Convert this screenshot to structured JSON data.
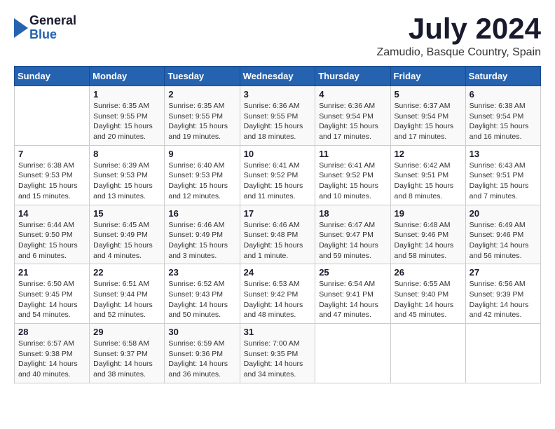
{
  "header": {
    "logo_line1": "General",
    "logo_line2": "Blue",
    "month": "July 2024",
    "location": "Zamudio, Basque Country, Spain"
  },
  "weekdays": [
    "Sunday",
    "Monday",
    "Tuesday",
    "Wednesday",
    "Thursday",
    "Friday",
    "Saturday"
  ],
  "weeks": [
    [
      {
        "day": "",
        "info": ""
      },
      {
        "day": "1",
        "info": "Sunrise: 6:35 AM\nSunset: 9:55 PM\nDaylight: 15 hours\nand 20 minutes."
      },
      {
        "day": "2",
        "info": "Sunrise: 6:35 AM\nSunset: 9:55 PM\nDaylight: 15 hours\nand 19 minutes."
      },
      {
        "day": "3",
        "info": "Sunrise: 6:36 AM\nSunset: 9:55 PM\nDaylight: 15 hours\nand 18 minutes."
      },
      {
        "day": "4",
        "info": "Sunrise: 6:36 AM\nSunset: 9:54 PM\nDaylight: 15 hours\nand 17 minutes."
      },
      {
        "day": "5",
        "info": "Sunrise: 6:37 AM\nSunset: 9:54 PM\nDaylight: 15 hours\nand 17 minutes."
      },
      {
        "day": "6",
        "info": "Sunrise: 6:38 AM\nSunset: 9:54 PM\nDaylight: 15 hours\nand 16 minutes."
      }
    ],
    [
      {
        "day": "7",
        "info": "Sunrise: 6:38 AM\nSunset: 9:53 PM\nDaylight: 15 hours\nand 15 minutes."
      },
      {
        "day": "8",
        "info": "Sunrise: 6:39 AM\nSunset: 9:53 PM\nDaylight: 15 hours\nand 13 minutes."
      },
      {
        "day": "9",
        "info": "Sunrise: 6:40 AM\nSunset: 9:53 PM\nDaylight: 15 hours\nand 12 minutes."
      },
      {
        "day": "10",
        "info": "Sunrise: 6:41 AM\nSunset: 9:52 PM\nDaylight: 15 hours\nand 11 minutes."
      },
      {
        "day": "11",
        "info": "Sunrise: 6:41 AM\nSunset: 9:52 PM\nDaylight: 15 hours\nand 10 minutes."
      },
      {
        "day": "12",
        "info": "Sunrise: 6:42 AM\nSunset: 9:51 PM\nDaylight: 15 hours\nand 8 minutes."
      },
      {
        "day": "13",
        "info": "Sunrise: 6:43 AM\nSunset: 9:51 PM\nDaylight: 15 hours\nand 7 minutes."
      }
    ],
    [
      {
        "day": "14",
        "info": "Sunrise: 6:44 AM\nSunset: 9:50 PM\nDaylight: 15 hours\nand 6 minutes."
      },
      {
        "day": "15",
        "info": "Sunrise: 6:45 AM\nSunset: 9:49 PM\nDaylight: 15 hours\nand 4 minutes."
      },
      {
        "day": "16",
        "info": "Sunrise: 6:46 AM\nSunset: 9:49 PM\nDaylight: 15 hours\nand 3 minutes."
      },
      {
        "day": "17",
        "info": "Sunrise: 6:46 AM\nSunset: 9:48 PM\nDaylight: 15 hours\nand 1 minute."
      },
      {
        "day": "18",
        "info": "Sunrise: 6:47 AM\nSunset: 9:47 PM\nDaylight: 14 hours\nand 59 minutes."
      },
      {
        "day": "19",
        "info": "Sunrise: 6:48 AM\nSunset: 9:46 PM\nDaylight: 14 hours\nand 58 minutes."
      },
      {
        "day": "20",
        "info": "Sunrise: 6:49 AM\nSunset: 9:46 PM\nDaylight: 14 hours\nand 56 minutes."
      }
    ],
    [
      {
        "day": "21",
        "info": "Sunrise: 6:50 AM\nSunset: 9:45 PM\nDaylight: 14 hours\nand 54 minutes."
      },
      {
        "day": "22",
        "info": "Sunrise: 6:51 AM\nSunset: 9:44 PM\nDaylight: 14 hours\nand 52 minutes."
      },
      {
        "day": "23",
        "info": "Sunrise: 6:52 AM\nSunset: 9:43 PM\nDaylight: 14 hours\nand 50 minutes."
      },
      {
        "day": "24",
        "info": "Sunrise: 6:53 AM\nSunset: 9:42 PM\nDaylight: 14 hours\nand 48 minutes."
      },
      {
        "day": "25",
        "info": "Sunrise: 6:54 AM\nSunset: 9:41 PM\nDaylight: 14 hours\nand 47 minutes."
      },
      {
        "day": "26",
        "info": "Sunrise: 6:55 AM\nSunset: 9:40 PM\nDaylight: 14 hours\nand 45 minutes."
      },
      {
        "day": "27",
        "info": "Sunrise: 6:56 AM\nSunset: 9:39 PM\nDaylight: 14 hours\nand 42 minutes."
      }
    ],
    [
      {
        "day": "28",
        "info": "Sunrise: 6:57 AM\nSunset: 9:38 PM\nDaylight: 14 hours\nand 40 minutes."
      },
      {
        "day": "29",
        "info": "Sunrise: 6:58 AM\nSunset: 9:37 PM\nDaylight: 14 hours\nand 38 minutes."
      },
      {
        "day": "30",
        "info": "Sunrise: 6:59 AM\nSunset: 9:36 PM\nDaylight: 14 hours\nand 36 minutes."
      },
      {
        "day": "31",
        "info": "Sunrise: 7:00 AM\nSunset: 9:35 PM\nDaylight: 14 hours\nand 34 minutes."
      },
      {
        "day": "",
        "info": ""
      },
      {
        "day": "",
        "info": ""
      },
      {
        "day": "",
        "info": ""
      }
    ]
  ]
}
